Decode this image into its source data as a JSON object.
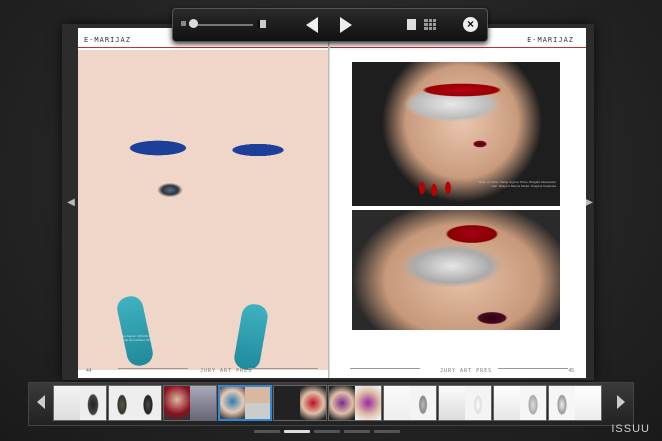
{
  "viewer": {
    "brand": "ISSUU",
    "toolbar": {
      "zoom_level": 0
    },
    "icons": {
      "zoom_out": "zoom-out-icon",
      "zoom_in": "zoom-in-icon",
      "prev": "previous-page-icon",
      "next": "next-page-icon",
      "single_page": "single-page-icon",
      "grid": "grid-view-icon",
      "close": "close-icon"
    }
  },
  "spread": {
    "left": {
      "masthead": "E-MARIJAZ",
      "footer": "JURY ART PRES",
      "page_number": "44",
      "credits": "Make-Up Artist: Marija Jugovic (MUAS) Photo: Bragalic Aleksander Hair: Milagros Bianca Styling: Zargoski Ilona Model: Dragana Kawleska"
    },
    "right": {
      "masthead": "E-MARIJAZ",
      "footer": "JURY ART PRES",
      "page_number": "45",
      "credits": "Make-Up Artist: Marija Jugovic Photo: Bragalic Aleksander Hair: Milagros Bianca Model: Dragana Kawleska"
    }
  },
  "thumbnails": {
    "active_index": 3,
    "count": 10
  },
  "pager": {
    "pages": 5,
    "active": 1
  },
  "colors": {
    "accent": "#2e8ad8",
    "masthead_rule": "#bb3333"
  }
}
